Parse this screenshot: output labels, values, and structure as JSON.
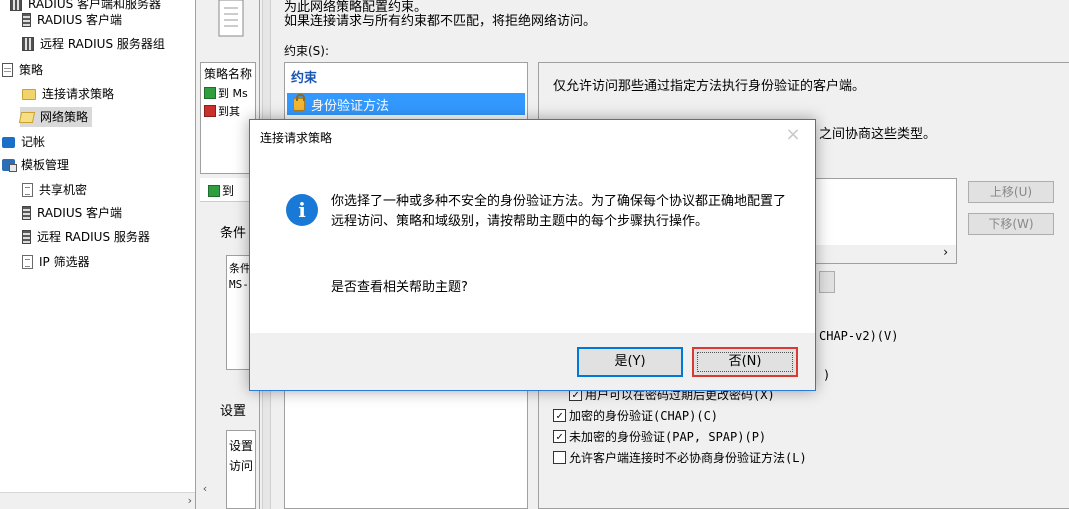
{
  "tree": {
    "items": [
      {
        "label": "RADIUS 客户端和服务器",
        "icon": "group-icon"
      },
      {
        "label": "RADIUS 客户端",
        "icon": "server-icon"
      },
      {
        "label": "远程 RADIUS 服务器组",
        "icon": "server-group-icon"
      },
      {
        "label": "策略",
        "icon": "policy-icon"
      },
      {
        "label": "连接请求策略",
        "icon": "folder-icon"
      },
      {
        "label": "网络策略",
        "icon": "folder-open-icon"
      },
      {
        "label": "记帐",
        "icon": "accounting-icon"
      },
      {
        "label": "模板管理",
        "icon": "template-icon"
      },
      {
        "label": "共享机密",
        "icon": "doc-icon"
      },
      {
        "label": "RADIUS 客户端",
        "icon": "server-icon"
      },
      {
        "label": "远程 RADIUS 服务器",
        "icon": "server-icon"
      },
      {
        "label": "IP 筛选器",
        "icon": "doc-icon"
      }
    ]
  },
  "mid": {
    "header": "策略名称",
    "rows": [
      "到 Ms",
      "到其"
    ],
    "titlebar": "到",
    "conditions_tab": "条件",
    "conditions_box": [
      "条件",
      "MS-"
    ],
    "settings_tab": "设置",
    "settings_box": [
      "设置",
      "访问"
    ]
  },
  "main": {
    "desc1": "为此网络策略配置约束。",
    "desc2": "如果连接请求与所有约束都不匹配，将拒绝网络访问。",
    "constraints_label": "约束(S):",
    "list_header": "约束",
    "selected_item": "身份验证方法",
    "detail_desc": "仅允许访问那些通过指定方法执行身份验证的客户端。",
    "detail_desc2": "之间协商这些类型。",
    "btn_up": "上移(U)",
    "btn_down": "下移(W)",
    "frag_chap2": "CHAP-v2)(V)",
    "frag_paren": ")",
    "chk_hidden": "用户可以在密码过期后更改密码(X)",
    "chk_chap": "加密的身份验证(CHAP)(C)",
    "chk_pap": "未加密的身份验证(PAP, SPAP)(P)",
    "chk_none": "允许客户端连接时不必协商身份验证方法(L)"
  },
  "dialog": {
    "title": "连接请求策略",
    "close": "×",
    "message": "你选择了一种或多种不安全的身份验证方法。为了确保每个协议都正确地配置了远程访问、策略和域级别，请按帮助主题中的每个步骤执行操作。",
    "question": "是否查看相关帮助主题?",
    "yes": "是(Y)",
    "no": "否(N)"
  },
  "colors": {
    "selection": "#3399ff",
    "dialog_border": "#2d7ad6",
    "yes_border": "#0078d7",
    "no_border": "#d93a32",
    "info_icon": "#1979d6"
  }
}
